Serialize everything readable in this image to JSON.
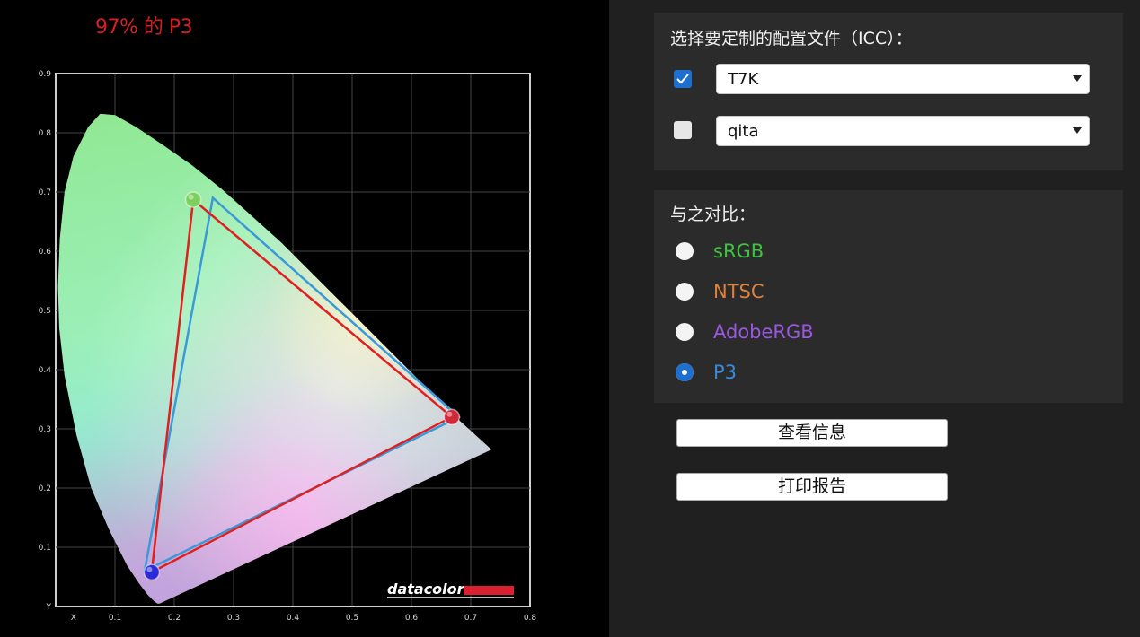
{
  "chart": {
    "coverage_text": "97% 的 P3",
    "y_ticks": [
      "0.9",
      "0.8",
      "0.7",
      "0.6",
      "0.5",
      "0.4",
      "0.3",
      "0.2",
      "0.1",
      "Y"
    ],
    "x_ticks": [
      "X",
      "0.1",
      "0.2",
      "0.3",
      "0.4",
      "0.5",
      "0.6",
      "0.7",
      "0.8"
    ],
    "logo": "datacolor",
    "colors": {
      "measured": "#e02020",
      "reference": "#3a9ad8"
    }
  },
  "chart_data": {
    "type": "scatter",
    "xlim": [
      0,
      0.8
    ],
    "ylim": [
      0,
      0.9
    ],
    "grid": true,
    "series": [
      {
        "name": "T7K",
        "points": [
          [
            0.232,
            0.687
          ],
          [
            0.668,
            0.32
          ],
          [
            0.162,
            0.058
          ]
        ],
        "closed": true
      },
      {
        "name": "P3",
        "points": [
          [
            0.265,
            0.69
          ],
          [
            0.68,
            0.32
          ],
          [
            0.15,
            0.06
          ]
        ],
        "closed": true
      }
    ]
  },
  "profile_panel": {
    "title": "选择要定制的配置文件（ICC）：",
    "rows": [
      {
        "checked": true,
        "value": "T7K"
      },
      {
        "checked": false,
        "value": "qita"
      }
    ]
  },
  "compare_panel": {
    "title": "与之对比：",
    "options": [
      {
        "label": "sRGB",
        "color": "#3ec43e",
        "selected": false
      },
      {
        "label": "NTSC",
        "color": "#e0803a",
        "selected": false
      },
      {
        "label": "AdobeRGB",
        "color": "#9a58e0",
        "selected": false
      },
      {
        "label": "P3",
        "color": "#3a8ad8",
        "selected": true
      }
    ]
  },
  "buttons": {
    "view_info": "查看信息",
    "print_report": "打印报告"
  }
}
